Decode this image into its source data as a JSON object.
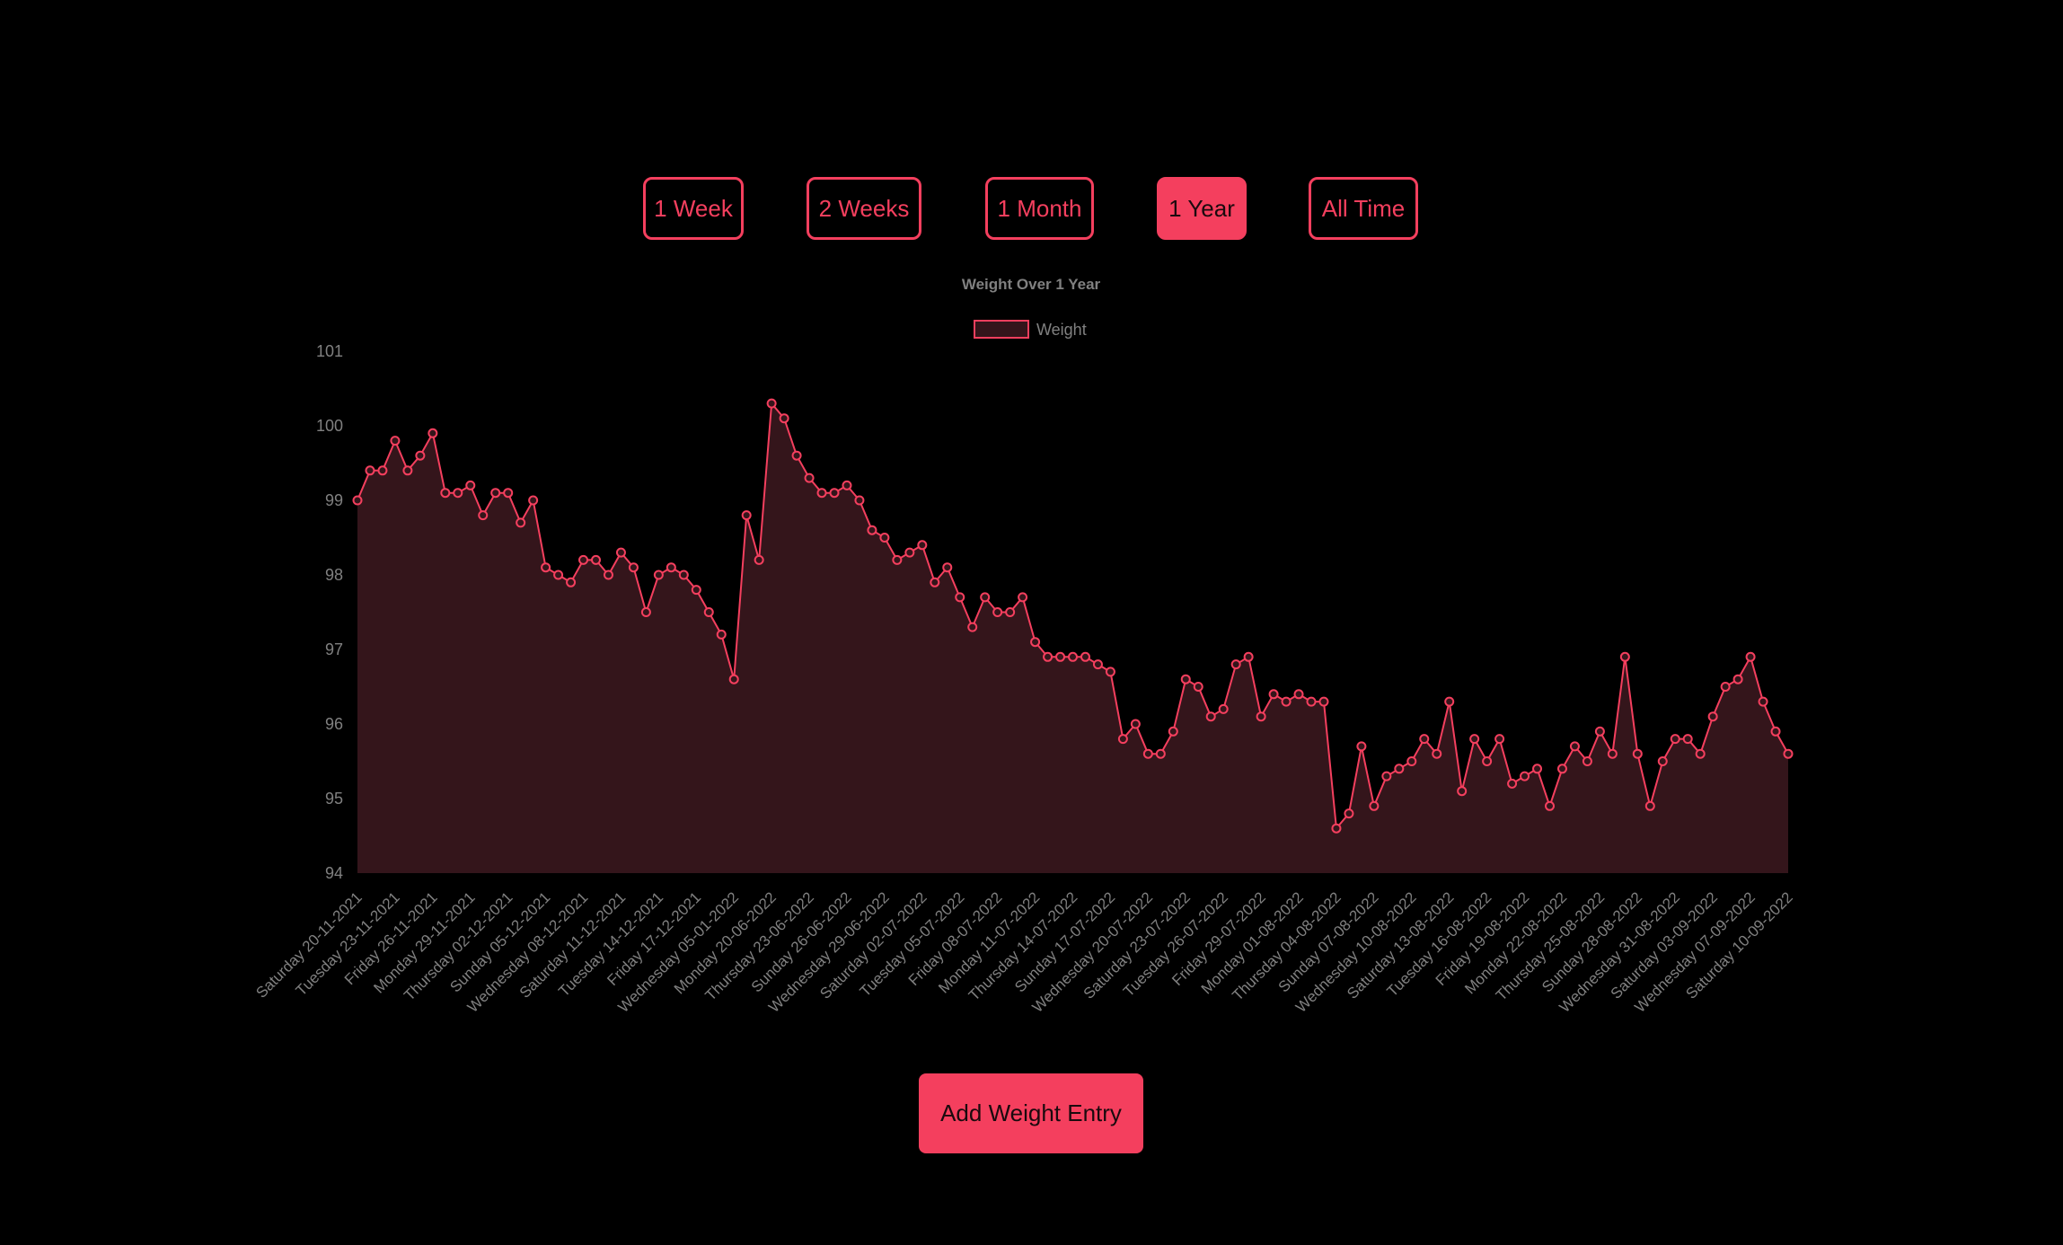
{
  "range_buttons": [
    {
      "label": "1 Week",
      "active": false
    },
    {
      "label": "2 Weeks",
      "active": false
    },
    {
      "label": "1 Month",
      "active": false
    },
    {
      "label": "1 Year",
      "active": true
    },
    {
      "label": "All Time",
      "active": false
    }
  ],
  "add_entry_label": "Add Weight Entry",
  "colors": {
    "accent": "#f43f5e",
    "fill": "#34151b",
    "text": "#808080",
    "background": "#000000"
  },
  "chart_data": {
    "type": "area",
    "title": "Weight Over 1 Year",
    "legend": {
      "position": "top",
      "label": "Weight"
    },
    "ylim": [
      94,
      101
    ],
    "yticks": [
      94,
      95,
      96,
      97,
      98,
      99,
      100,
      101
    ],
    "grid": false,
    "x_tick_labels": [
      "Saturday 20-11-2021",
      "Tuesday 23-11-2021",
      "Friday 26-11-2021",
      "Monday 29-11-2021",
      "Thursday 02-12-2021",
      "Sunday 05-12-2021",
      "Wednesday 08-12-2021",
      "Saturday 11-12-2021",
      "Tuesday 14-12-2021",
      "Friday 17-12-2021",
      "Wednesday 05-01-2022",
      "Monday 20-06-2022",
      "Thursday 23-06-2022",
      "Sunday 26-06-2022",
      "Wednesday 29-06-2022",
      "Saturday 02-07-2022",
      "Tuesday 05-07-2022",
      "Friday 08-07-2022",
      "Monday 11-07-2022",
      "Thursday 14-07-2022",
      "Sunday 17-07-2022",
      "Wednesday 20-07-2022",
      "Saturday 23-07-2022",
      "Tuesday 26-07-2022",
      "Friday 29-07-2022",
      "Monday 01-08-2022",
      "Thursday 04-08-2022",
      "Sunday 07-08-2022",
      "Wednesday 10-08-2022",
      "Saturday 13-08-2022",
      "Tuesday 16-08-2022",
      "Friday 19-08-2022",
      "Monday 22-08-2022",
      "Thursday 25-08-2022",
      "Sunday 28-08-2022",
      "Wednesday 31-08-2022",
      "Saturday 03-09-2022",
      "Wednesday 07-09-2022",
      "Saturday 10-09-2022"
    ],
    "series": [
      {
        "name": "Weight",
        "values": [
          99.0,
          99.4,
          99.4,
          99.8,
          99.4,
          99.6,
          99.9,
          99.1,
          99.1,
          99.2,
          98.8,
          99.1,
          99.1,
          98.7,
          99.0,
          98.1,
          98.0,
          97.9,
          98.2,
          98.2,
          98.0,
          98.3,
          98.1,
          97.5,
          98.0,
          98.1,
          98.0,
          97.8,
          97.5,
          97.2,
          96.6,
          98.8,
          98.2,
          100.3,
          100.1,
          99.6,
          99.3,
          99.1,
          99.1,
          99.2,
          99.0,
          98.6,
          98.5,
          98.2,
          98.3,
          98.4,
          97.9,
          98.1,
          97.7,
          97.3,
          97.7,
          97.5,
          97.5,
          97.7,
          97.1,
          96.9,
          96.9,
          96.9,
          96.9,
          96.8,
          96.7,
          95.8,
          96.0,
          95.6,
          95.6,
          95.9,
          96.6,
          96.5,
          96.1,
          96.2,
          96.8,
          96.9,
          96.1,
          96.4,
          96.3,
          96.4,
          96.3,
          96.3,
          94.6,
          94.8,
          95.7,
          94.9,
          95.3,
          95.4,
          95.5,
          95.8,
          95.6,
          96.3,
          95.1,
          95.8,
          95.5,
          95.8,
          95.2,
          95.3,
          95.4,
          94.9,
          95.4,
          95.7,
          95.5,
          95.9,
          95.6,
          96.9,
          95.6,
          94.9,
          95.5,
          95.8,
          95.8,
          95.6,
          96.1,
          96.5,
          96.6,
          96.9,
          96.3,
          95.9,
          95.6
        ]
      }
    ]
  }
}
